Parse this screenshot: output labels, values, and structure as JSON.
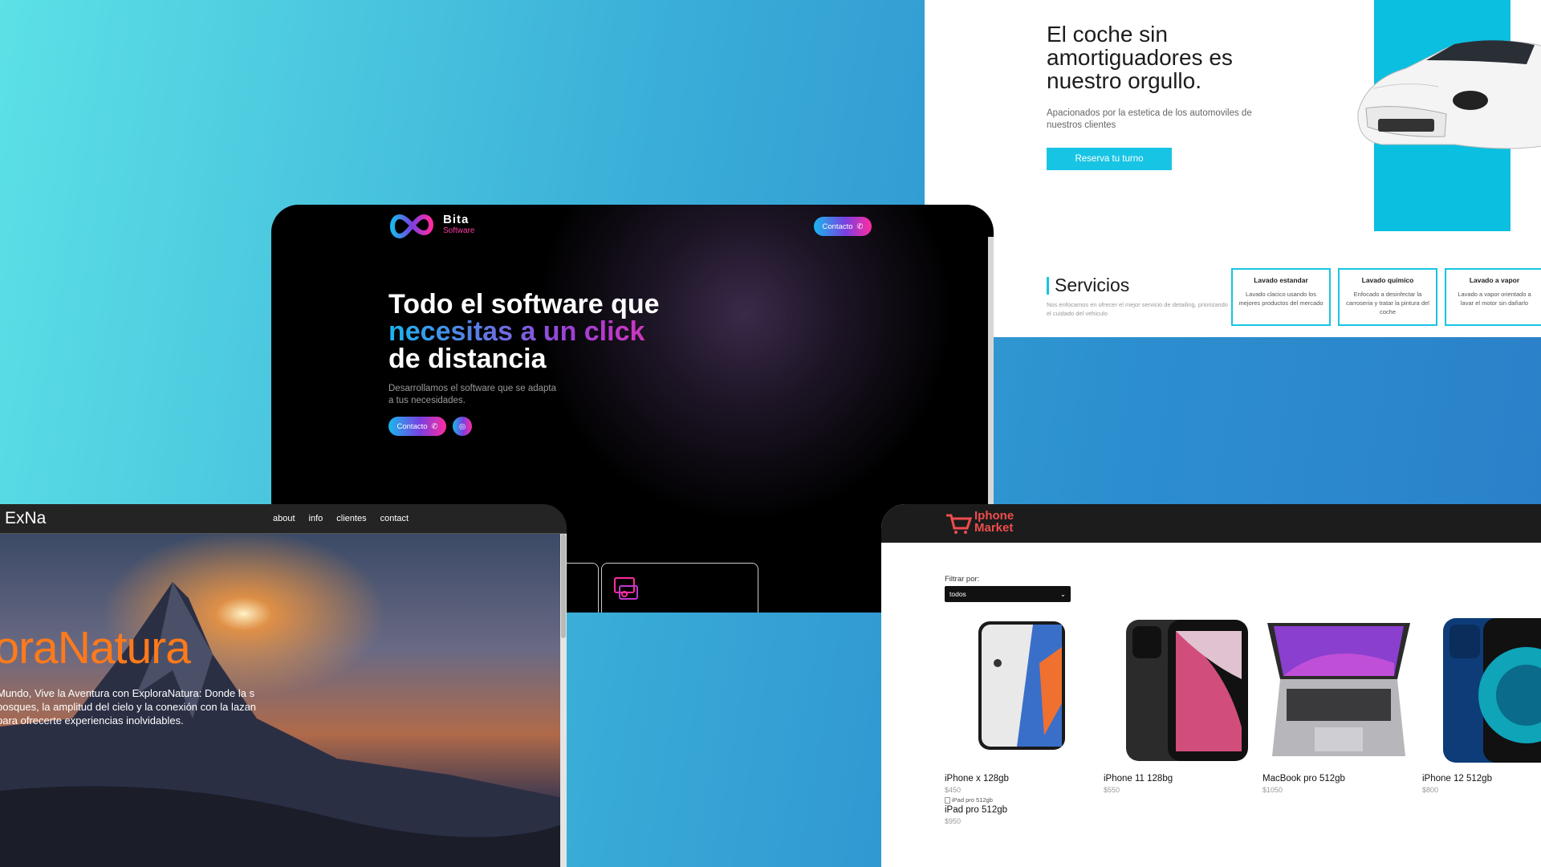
{
  "car_wash": {
    "title": "El coche sin amortiguadores es nuestro orgullo.",
    "subtitle": "Apacionados por la estetica de los automoviles de nuestros clientes",
    "cta": "Reserva tu turno",
    "services_title": "Servicios",
    "services_desc": "Nos enfocamos en ofrecer el mejor servicio de detailing, priorizando el cuidado del vehiculo",
    "cards": [
      {
        "title": "Lavado estandar",
        "text": "Lavado clacico usando los mejores productos del mercado"
      },
      {
        "title": "Lavado químico",
        "text": "Enfocado a desinfectar la carroseria y tratar la pintura del coche"
      },
      {
        "title": "Lavado a vapor",
        "text": "Lavado a vapor orientado a lavar el motor sin dañarlo"
      }
    ],
    "accent": "#18c4e3"
  },
  "bita": {
    "logo_main": "Bita",
    "logo_sub": "Software",
    "nav_cta": "Contacto",
    "headline_1": "Todo el software que",
    "headline_2": "necesitas a un click",
    "headline_3": "de distancia",
    "subtitle": "Desarrollamos el software que se adapta a tus necesidades.",
    "hero_cta": "Contacto",
    "icons": [
      "whatsapp-icon",
      "instagram-icon",
      "devices-icon",
      "payment-icon"
    ]
  },
  "explora": {
    "brand": "ExNa",
    "nav": [
      "about",
      "info",
      "clientes",
      "contact"
    ],
    "headline": "ploraNatura",
    "paragraph": "Mundo, Vive la Aventura con ExploraNatura: Donde la s bosques, la amplitud del cielo y la conexión con la lazan para ofrecerte experiencias inolvidables.",
    "accent": "#ff7a1a"
  },
  "shop": {
    "logo_line1": "Iphone",
    "logo_line2": "Market",
    "filter_label": "Filtrar por:",
    "filter_value": "todos",
    "products": [
      {
        "name": "iPhone x 128gb",
        "price": "$450"
      },
      {
        "name": "iPhone 11 128bg",
        "price": "$550"
      },
      {
        "name": "MacBook pro 512gb",
        "price": "$1050"
      },
      {
        "name": "iPhone 12 512gb",
        "price": "$800"
      }
    ],
    "ipad": {
      "alt": "iPad pro 512gb",
      "name": "iPad pro 512gb",
      "price": "$950"
    },
    "accent": "#ef4d4d"
  }
}
